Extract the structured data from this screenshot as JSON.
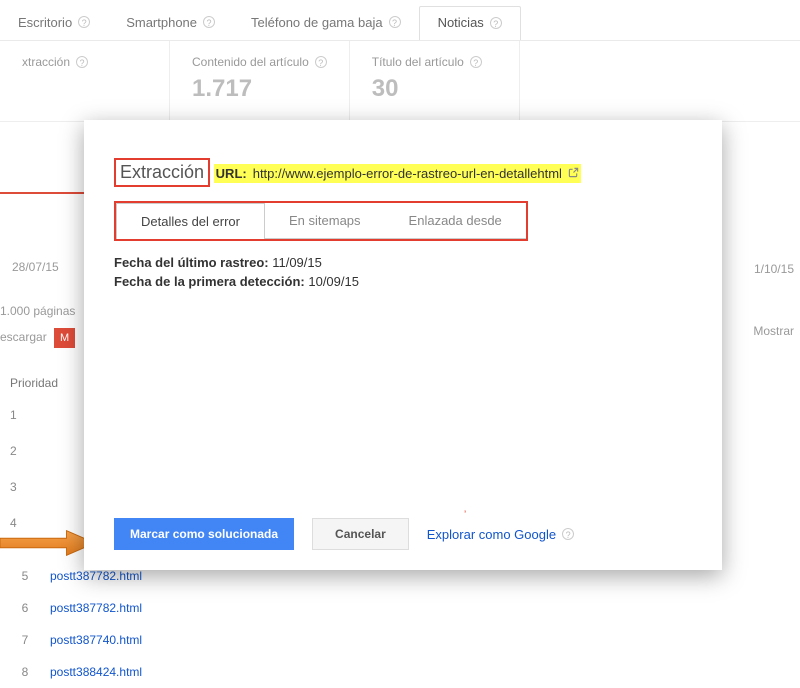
{
  "topnav": {
    "tabs": [
      {
        "label": "Escritorio"
      },
      {
        "label": "Smartphone"
      },
      {
        "label": "Teléfono de gama baja"
      },
      {
        "label": "Noticias"
      }
    ],
    "selected_index": 3
  },
  "cards": [
    {
      "label": "xtracción",
      "value": ""
    },
    {
      "label": "Contenido del artículo",
      "value": "1.717"
    },
    {
      "label": "Título del artículo",
      "value": "30"
    }
  ],
  "background": {
    "left_date": "28/07/15",
    "pages_text": "1.000 páginas",
    "download_label": "escargar",
    "priority_header": "Prioridad",
    "rows": [
      {
        "n": "1",
        "url": ""
      },
      {
        "n": "2",
        "url": ""
      },
      {
        "n": "3",
        "url": ""
      },
      {
        "n": "4",
        "url": ""
      },
      {
        "n": "5",
        "url": "postt387782.html"
      },
      {
        "n": "6",
        "url": "postt387782.html"
      },
      {
        "n": "7",
        "url": "postt387740.html"
      },
      {
        "n": "8",
        "url": "postt388424.html"
      }
    ],
    "right_date": "1/10/15",
    "show_label": "Mostrar"
  },
  "modal": {
    "title": "Extracción",
    "url_label": "URL:",
    "url_value": "http://www.ejemplo-error-de-rastreo-url-en-detallehtml",
    "tabs": [
      {
        "label": "Detalles del error"
      },
      {
        "label": "En sitemaps"
      },
      {
        "label": "Enlazada desde"
      }
    ],
    "active_tab_index": 0,
    "details": {
      "last_crawl_label": "Fecha del último rastreo:",
      "last_crawl_value": "11/09/15",
      "first_detect_label": "Fecha de la primera detección:",
      "first_detect_value": "10/09/15"
    },
    "footer": {
      "mark_fixed": "Marcar como solucionada",
      "cancel": "Cancelar",
      "fetch_as_google": "Explorar como Google"
    }
  }
}
